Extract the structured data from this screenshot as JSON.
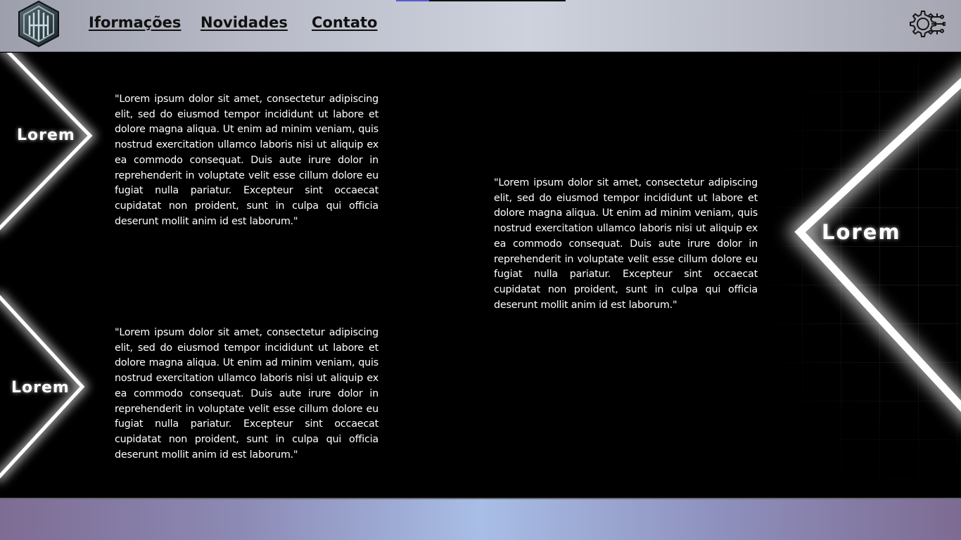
{
  "header": {
    "logo_icon": "hexagon-logo-icon",
    "nav": {
      "info": "Iformações",
      "news": "Novidades",
      "contact": "Contato"
    },
    "settings_icon": "gear-circuit-icon"
  },
  "sections": [
    {
      "label": "Lorem",
      "text": "\"Lorem ipsum dolor sit amet, consectetur adipiscing elit, sed do eiusmod tempor incididunt ut labore et dolore magna aliqua. Ut enim ad minim veniam, quis nostrud exercitation ullamco laboris nisi ut aliquip ex ea commodo consequat. Duis aute irure dolor in reprehenderit in voluptate velit esse cillum dolore eu fugiat nulla pariatur. Excepteur sint occaecat cupidatat non proident, sunt in culpa qui officia deserunt mollit anim id est laborum.\""
    },
    {
      "label": "Lorem",
      "text": "\"Lorem ipsum dolor sit amet, consectetur adipiscing elit, sed do eiusmod tempor incididunt ut labore et dolore magna aliqua. Ut enim ad minim veniam, quis nostrud exercitation ullamco laboris nisi ut aliquip ex ea commodo consequat. Duis aute irure dolor in reprehenderit in voluptate velit esse cillum dolore eu fugiat nulla pariatur. Excepteur sint occaecat cupidatat non proident, sunt in culpa qui officia deserunt mollit anim id est laborum.\""
    },
    {
      "label": "Lorem",
      "text": "\"Lorem ipsum dolor sit amet, consectetur adipiscing elit, sed do eiusmod tempor incididunt ut labore et dolore magna aliqua. Ut enim ad minim veniam, quis nostrud exercitation ullamco laboris nisi ut aliquip ex ea commodo consequat. Duis aute irure dolor in reprehenderit in voluptate velit esse cillum dolore eu fugiat nulla pariatur. Excepteur sint occaecat cupidatat non proident, sunt in culpa qui officia deserunt mollit anim id est laborum.\""
    }
  ],
  "colors": {
    "background": "#000000",
    "text": "#ffffff",
    "header_gradient_center": "#cdd2dd",
    "footer_gradient_center": "#a8bee6",
    "footer_gradient_edge": "#7e6c93",
    "accent": "#5a5ad0"
  }
}
